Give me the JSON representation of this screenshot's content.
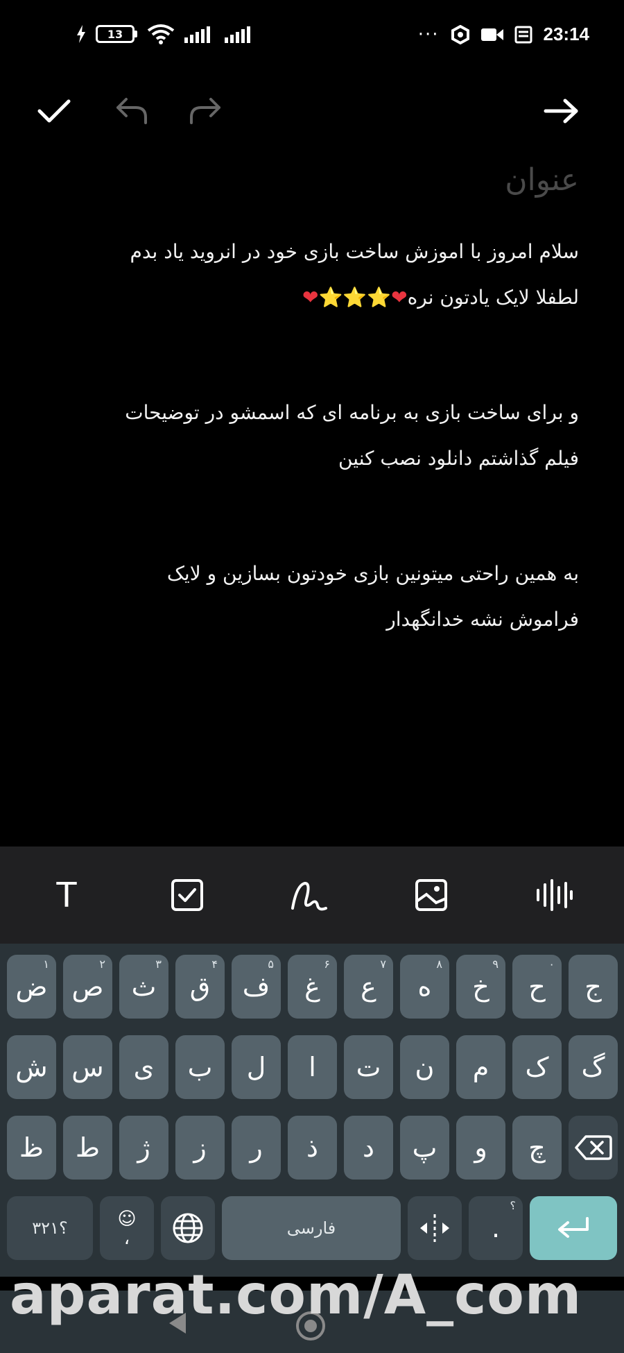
{
  "status_bar": {
    "battery": "13",
    "time": "23:14",
    "overflow": "···"
  },
  "toolbar": {
    "done_icon": "check-icon",
    "undo_icon": "undo-icon",
    "redo_icon": "redo-icon",
    "forward_icon": "arrow-right-icon"
  },
  "note": {
    "title_placeholder": "عنوان",
    "lines": [
      "سلام امروز با اموزش ساخت بازی خود در انروید یاد بدم",
      "لطفلا لایک یادتون نره",
      "و برای ساخت بازی به برنامه ای که اسمشو در توضیحات",
      "فیلم گذاشتم دانلود نصب کنین",
      "به همین راحتی میتونین بازی خودتون بسازین و لایک",
      "فراموش نشه خدانگهدار"
    ],
    "emoji_row": "❤⭐⭐⭐❤"
  },
  "format_bar": {
    "items": [
      "text-format-icon",
      "checkbox-icon",
      "draw-icon",
      "image-icon",
      "audio-icon"
    ],
    "text_glyph": "T"
  },
  "keyboard": {
    "row1": [
      "ض",
      "ص",
      "ث",
      "ق",
      "ف",
      "غ",
      "ع",
      "ه",
      "خ",
      "ح",
      "ج"
    ],
    "row1_hints": [
      "۱",
      "۲",
      "۳",
      "۴",
      "۵",
      "۶",
      "۷",
      "۸",
      "۹",
      "۰",
      ""
    ],
    "row2": [
      "ش",
      "س",
      "ی",
      "ب",
      "ل",
      "ا",
      "ت",
      "ن",
      "م",
      "ک",
      "گ"
    ],
    "row3": [
      "ظ",
      "ط",
      "ژ",
      "ز",
      "ر",
      "ذ",
      "د",
      "پ",
      "و",
      "چ"
    ],
    "symbols_key": "؟۳۲۱",
    "emoji_key_top": "☺",
    "emoji_key_bottom": "،",
    "space_label": "فارسی",
    "period_key": ".",
    "period_hint": "؟"
  },
  "watermark": "aparat.com/A_com"
}
